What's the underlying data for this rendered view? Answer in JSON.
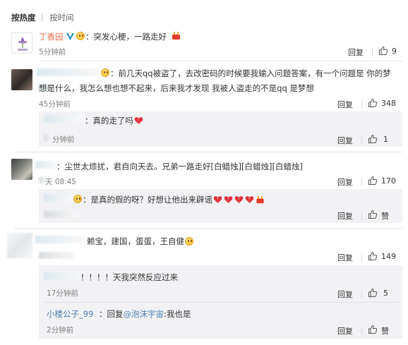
{
  "sort": {
    "hot": "按热度",
    "time": "按时间"
  },
  "comments": [
    {
      "name": "丁香园",
      "text": "：突发心梗，一路走好",
      "time": "5分钟前",
      "reply": "回复",
      "likes": "9"
    },
    {
      "text_line1": "：前几天qq被盗了，去改密码的时候要我输入问题答案，有一个问题是 你的梦",
      "text_line2": "想是什么，我怎么想也想不起来，后来我才发现 我被人盗走的不是qq 是梦想",
      "time": "45分钟前",
      "reply": "回复",
      "likes": "348",
      "sub": {
        "text": "：真的走了吗",
        "time": "分钟前",
        "reply": "回复",
        "likes": "1"
      }
    },
    {
      "text": "：尘世太烦扰，君自向天去。兄弟一路走好[白蜡烛][白蜡烛][白蜡烛]",
      "time": "天 08:45",
      "reply": "回复",
      "likes": "170",
      "sub": {
        "text": "：是真的假的呀？好想让他出来辟谣",
        "time": "",
        "reply": "回复",
        "likes": "赞"
      }
    },
    {
      "text": "赖宝，建国，蛋蛋，王自健",
      "time": "",
      "reply": "回复",
      "likes": "149",
      "subs": [
        {
          "text": "！！！！天我突然反应过来",
          "time": "17分钟前",
          "reply": "回复",
          "likes": "5"
        },
        {
          "name": "小楼公子_99",
          "text_pre": "：回复",
          "mention": "@泡沫宇宙",
          "text_post": ":我也是",
          "time": "2分钟前",
          "reply": "回复",
          "likes": "赞"
        }
      ]
    }
  ],
  "colors": {
    "name": "#eb7350",
    "link": "#507daf",
    "sub_bg": "#f2f2f5",
    "vip": "#1e90d8"
  }
}
